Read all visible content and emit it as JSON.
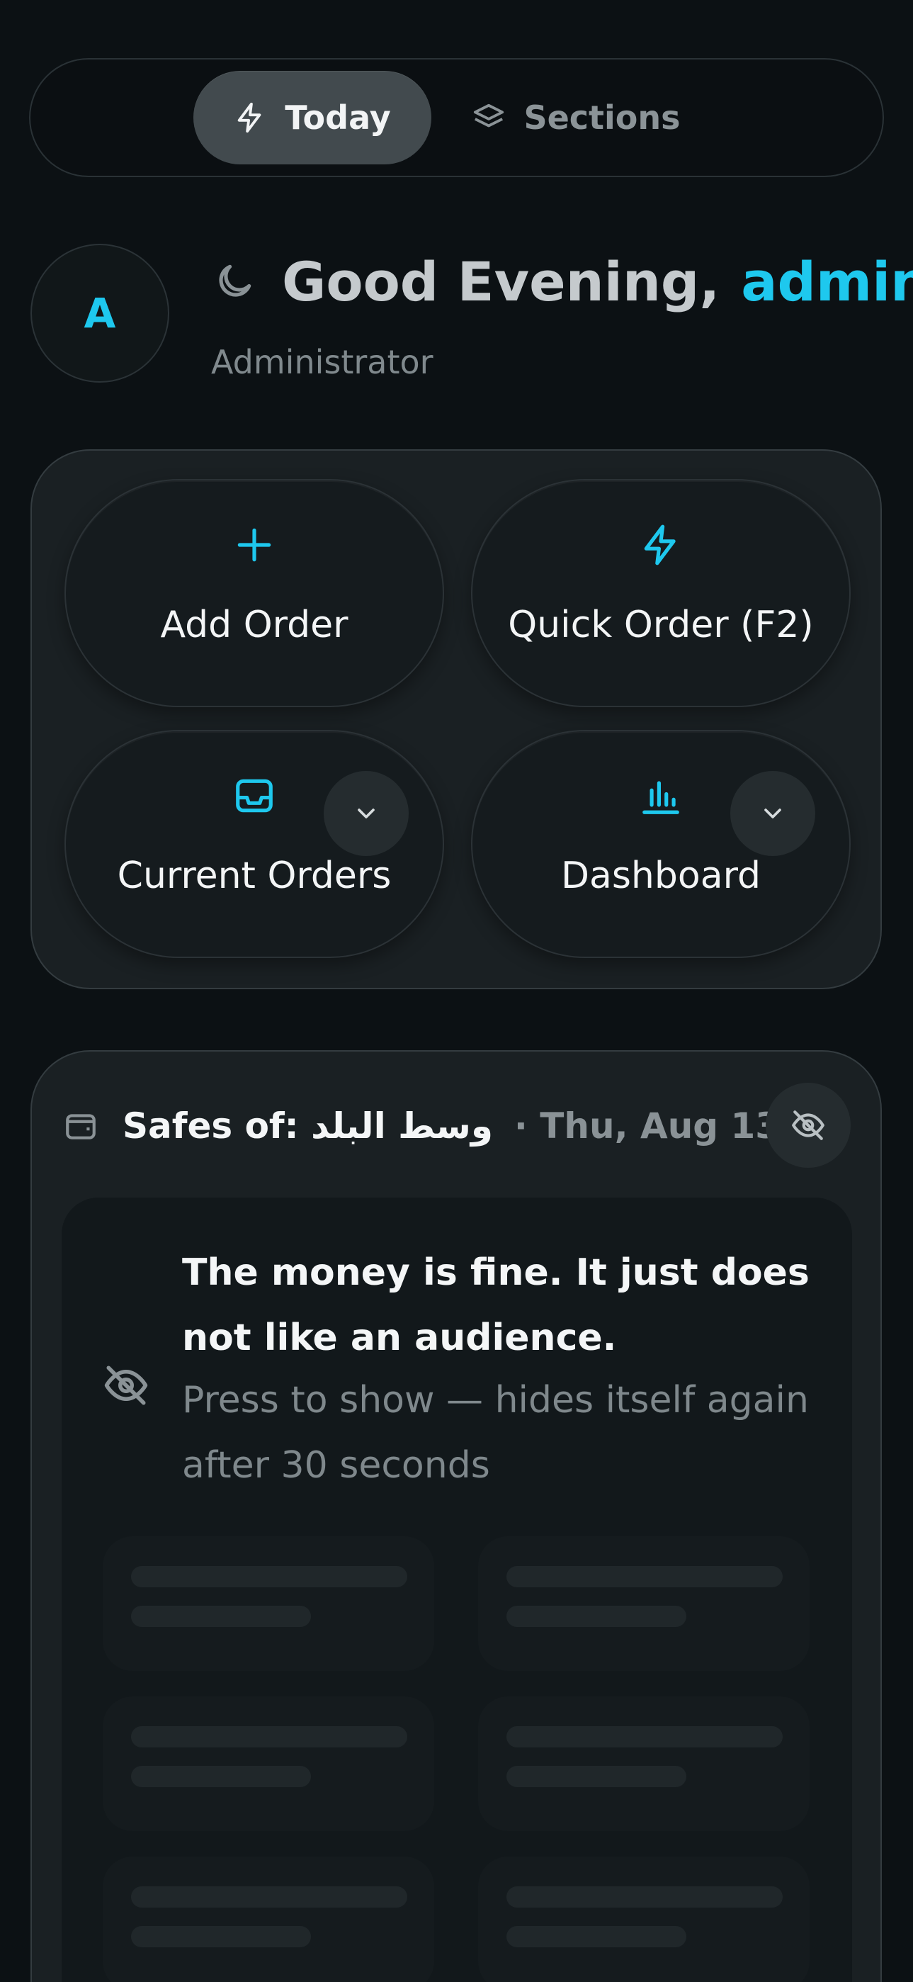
{
  "nav": {
    "tabs": [
      {
        "label": "Today",
        "icon": "lightning-icon",
        "active": true
      },
      {
        "label": "Sections",
        "icon": "layers-icon",
        "active": false
      }
    ]
  },
  "greeting": {
    "avatar_initial": "A",
    "salutation": "Good Evening,",
    "username": "admin",
    "role": "Administrator",
    "icon": "moon-icon"
  },
  "actions": [
    {
      "label": "Add Order",
      "icon": "plus-icon",
      "has_dropdown": false
    },
    {
      "label": "Quick Order (F2)",
      "icon": "lightning-icon",
      "has_dropdown": false
    },
    {
      "label": "Current Orders",
      "icon": "inbox-icon",
      "has_dropdown": true
    },
    {
      "label": "Dashboard",
      "icon": "bar-chart-icon",
      "has_dropdown": true
    }
  ],
  "safes": {
    "title": "Safes of: وسط البلد",
    "date": "· Thu, Aug 13",
    "notice_title": "The money is fine. It just does not like an audience.",
    "notice_subtitle": "Press to show — hides itself again after 30 seconds"
  },
  "colors": {
    "accent": "#1ec8ee",
    "background": "#0c1114",
    "panel": "#1a2023"
  }
}
